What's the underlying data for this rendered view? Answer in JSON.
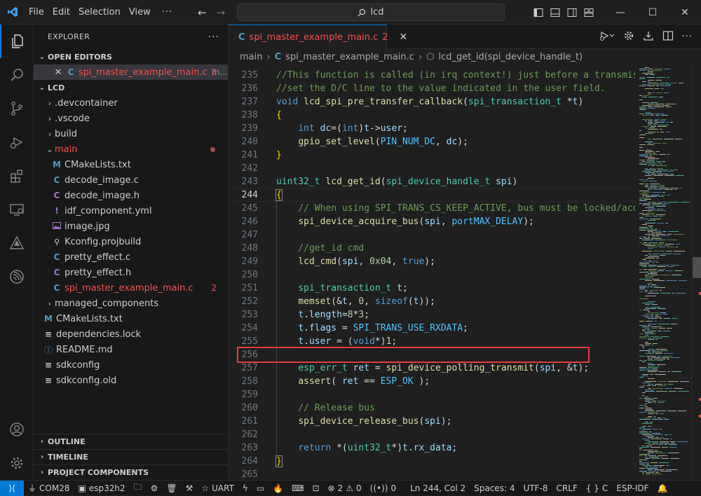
{
  "titlebar": {
    "menu": [
      "File",
      "Edit",
      "Selection",
      "View"
    ],
    "search_text": "lcd"
  },
  "sidebar": {
    "title": "EXPLORER",
    "open_editors_title": "OPEN EDITORS",
    "open_editor": {
      "name": "spi_master_example_main.c",
      "suffix": "m...",
      "badge": "2"
    },
    "root": "LCD",
    "tree": {
      "devcontainer": ".devcontainer",
      "vscode": ".vscode",
      "build": "build",
      "main": "main",
      "main_files": [
        "CMakeLists.txt",
        "decode_image.c",
        "decode_image.h",
        "idf_component.yml",
        "image.jpg",
        "Kconfig.projbuild",
        "pretty_effect.c",
        "pretty_effect.h",
        "spi_master_example_main.c"
      ],
      "main_badge": "2",
      "managed_components": "managed_components",
      "root_files": [
        "CMakeLists.txt",
        "dependencies.lock",
        "README.md",
        "sdkconfig",
        "sdkconfig.old"
      ]
    },
    "outline": "OUTLINE",
    "timeline": "TIMELINE",
    "project_components": "PROJECT COMPONENTS"
  },
  "editor": {
    "tab": {
      "name": "spi_master_example_main.c",
      "badge": "2"
    },
    "breadcrumb": {
      "folder": "main",
      "file": "spi_master_example_main.c",
      "symbol": "lcd_get_id(spi_device_handle_t)"
    },
    "line_numbers": [
      "235",
      "236",
      "237",
      "238",
      "239",
      "240",
      "241",
      "242",
      "243",
      "244",
      "245",
      "246",
      "247",
      "248",
      "249",
      "250",
      "251",
      "252",
      "253",
      "254",
      "255",
      "256",
      "257",
      "258",
      "259",
      "260",
      "261",
      "262",
      "263",
      "264",
      "265"
    ],
    "current_line": "244"
  },
  "statusbar": {
    "port": "COM28",
    "target": "esp32h2",
    "uart": "UART",
    "errors": "2",
    "warnings": "0",
    "ports": "0",
    "position": "Ln 244, Col 2",
    "spaces": "Spaces: 4",
    "encoding": "UTF-8",
    "eol": "CRLF",
    "language": "C",
    "framework": "ESP-IDF"
  },
  "colors": {
    "accent": "#0078d4",
    "error": "#f14c4c",
    "highlight_box": "#e03c3c"
  }
}
